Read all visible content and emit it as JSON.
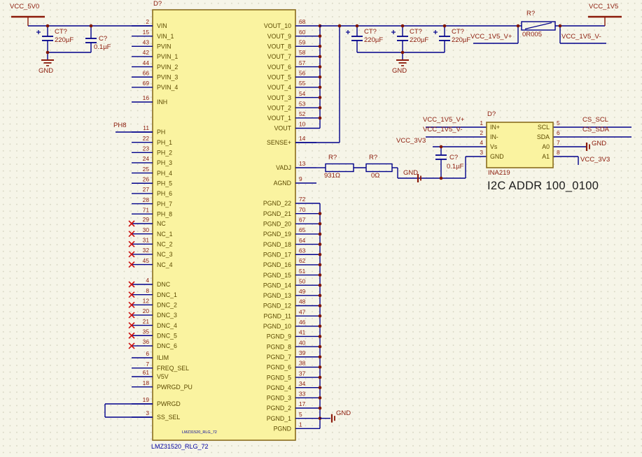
{
  "colors": {
    "background": "#f6f5e8",
    "grid_dot": "#d8d7c4",
    "wire": "#00008b",
    "junction": "#801400",
    "component_fill": "#faf3a0",
    "component_border": "#8a6d1e",
    "red_text": "#8b1a0a",
    "pin_name": "#5c4a00",
    "blue_text": "#0000a0",
    "black_text": "#1c1c1c",
    "no_connect": "#cc1111"
  },
  "power_ports": {
    "vcc_5v0": "VCC_5V0",
    "vcc_1v5": "VCC_1V5",
    "gnd": "GND"
  },
  "net_labels": {
    "ph8": "PH8",
    "vcc_1v5_vp": "VCC_1V5_V+",
    "vcc_1v5_vm": "VCC_1V5_V-",
    "vcc_3v3": "VCC_3V3",
    "cs_scl": "CS_SCL",
    "cs_sda": "CS_SDA"
  },
  "capacitors": {
    "c_in_bulk": {
      "ref": "CT?",
      "value": "220µF"
    },
    "c_in_hf": {
      "ref": "C?",
      "value": "0.1µF"
    },
    "c_out_1": {
      "ref": "CT?",
      "value": "220µF"
    },
    "c_out_2": {
      "ref": "CT?",
      "value": "220µF"
    },
    "c_out_3": {
      "ref": "CT?",
      "value": "220µF"
    },
    "c_ina": {
      "ref": "C?",
      "value": "0.1µF"
    }
  },
  "resistors": {
    "shunt": {
      "ref": "R?",
      "value": "0R005"
    },
    "r_vadj_1": {
      "ref": "R?",
      "value": "931Ω"
    },
    "r_vadj_2": {
      "ref": "R?",
      "value": "0Ω"
    }
  },
  "annotation": {
    "i2c_addr": "I2C ADDR 100_0100"
  },
  "main_ic": {
    "designator": "D?",
    "comment": "LMZ31520_RLG_72",
    "inner_label": "LMZ31520_RLG_72",
    "left_pins": [
      {
        "num": "2",
        "name": "VIN"
      },
      {
        "num": "15",
        "name": "VIN_1"
      },
      {
        "num": "43",
        "name": "PVIN"
      },
      {
        "num": "42",
        "name": "PVIN_1"
      },
      {
        "num": "44",
        "name": "PVIN_2"
      },
      {
        "num": "66",
        "name": "PVIN_3"
      },
      {
        "num": "69",
        "name": "PVIN_4"
      },
      {
        "num": "16",
        "name": "INH"
      },
      {
        "num": "11",
        "name": "PH"
      },
      {
        "num": "22",
        "name": "PH_1"
      },
      {
        "num": "23",
        "name": "PH_2"
      },
      {
        "num": "24",
        "name": "PH_3"
      },
      {
        "num": "25",
        "name": "PH_4"
      },
      {
        "num": "26",
        "name": "PH_5"
      },
      {
        "num": "27",
        "name": "PH_6"
      },
      {
        "num": "28",
        "name": "PH_7"
      },
      {
        "num": "71",
        "name": "PH_8"
      },
      {
        "num": "29",
        "name": "NC",
        "nc": true
      },
      {
        "num": "30",
        "name": "NC_1",
        "nc": true
      },
      {
        "num": "31",
        "name": "NC_2",
        "nc": true
      },
      {
        "num": "32",
        "name": "NC_3",
        "nc": true
      },
      {
        "num": "45",
        "name": "NC_4",
        "nc": true
      },
      {
        "num": "4",
        "name": "DNC",
        "nc": true
      },
      {
        "num": "8",
        "name": "DNC_1",
        "nc": true
      },
      {
        "num": "12",
        "name": "DNC_2",
        "nc": true
      },
      {
        "num": "20",
        "name": "DNC_3",
        "nc": true
      },
      {
        "num": "21",
        "name": "DNC_4",
        "nc": true
      },
      {
        "num": "35",
        "name": "DNC_5",
        "nc": true
      },
      {
        "num": "36",
        "name": "DNC_6",
        "nc": true
      },
      {
        "num": "6",
        "name": "ILIM"
      },
      {
        "num": "7",
        "name": "FREQ_SEL"
      },
      {
        "num": "61",
        "name": "V5V"
      },
      {
        "num": "18",
        "name": "PWRGD_PU"
      },
      {
        "num": "19",
        "name": "PWRGD"
      },
      {
        "num": "3",
        "name": "SS_SEL"
      }
    ],
    "right_pins": [
      {
        "num": "68",
        "name": "VOUT_10"
      },
      {
        "num": "60",
        "name": "VOUT_9"
      },
      {
        "num": "59",
        "name": "VOUT_8"
      },
      {
        "num": "58",
        "name": "VOUT_7"
      },
      {
        "num": "57",
        "name": "VOUT_6"
      },
      {
        "num": "56",
        "name": "VOUT_5"
      },
      {
        "num": "55",
        "name": "VOUT_4"
      },
      {
        "num": "54",
        "name": "VOUT_3"
      },
      {
        "num": "53",
        "name": "VOUT_2"
      },
      {
        "num": "52",
        "name": "VOUT_1"
      },
      {
        "num": "10",
        "name": "VOUT"
      },
      {
        "num": "14",
        "name": "SENSE+"
      },
      {
        "num": "13",
        "name": "VADJ"
      },
      {
        "num": "9",
        "name": "AGND"
      },
      {
        "num": "72",
        "name": "PGND_22"
      },
      {
        "num": "70",
        "name": "PGND_21"
      },
      {
        "num": "67",
        "name": "PGND_20"
      },
      {
        "num": "65",
        "name": "PGND_19"
      },
      {
        "num": "64",
        "name": "PGND_18"
      },
      {
        "num": "63",
        "name": "PGND_17"
      },
      {
        "num": "62",
        "name": "PGND_16"
      },
      {
        "num": "51",
        "name": "PGND_15"
      },
      {
        "num": "50",
        "name": "PGND_14"
      },
      {
        "num": "49",
        "name": "PGND_13"
      },
      {
        "num": "48",
        "name": "PGND_12"
      },
      {
        "num": "47",
        "name": "PGND_11"
      },
      {
        "num": "46",
        "name": "PGND_10"
      },
      {
        "num": "41",
        "name": "PGND_9"
      },
      {
        "num": "40",
        "name": "PGND_8"
      },
      {
        "num": "39",
        "name": "PGND_7"
      },
      {
        "num": "38",
        "name": "PGND_6"
      },
      {
        "num": "37",
        "name": "PGND_5"
      },
      {
        "num": "34",
        "name": "PGND_4"
      },
      {
        "num": "33",
        "name": "PGND_3"
      },
      {
        "num": "17",
        "name": "PGND_2"
      },
      {
        "num": "5",
        "name": "PGND_1"
      },
      {
        "num": "1",
        "name": "PGND"
      }
    ]
  },
  "ina219": {
    "designator": "D?",
    "name": "INA219",
    "left_pins": [
      {
        "num": "1",
        "name": "IN+"
      },
      {
        "num": "2",
        "name": "IN-"
      },
      {
        "num": "4",
        "name": "Vs"
      },
      {
        "num": "3",
        "name": "GND"
      }
    ],
    "right_pins": [
      {
        "num": "5",
        "name": "SCL"
      },
      {
        "num": "6",
        "name": "SDA"
      },
      {
        "num": "7",
        "name": "A0"
      },
      {
        "num": "8",
        "name": "A1"
      }
    ]
  }
}
